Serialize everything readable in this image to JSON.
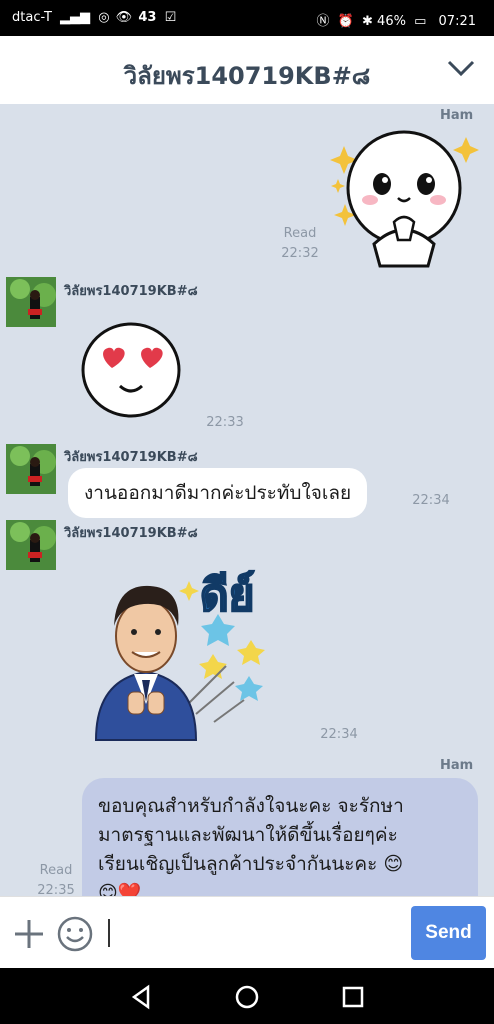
{
  "status_bar": {
    "carrier": "dtac-T",
    "notification_count": "43",
    "battery": "46%",
    "time": "07:21"
  },
  "header": {
    "title": "วิลัยพร140719KB#๘"
  },
  "messages": [
    {
      "side": "out",
      "type": "sticker",
      "sender": "Ham",
      "status": "Read",
      "time": "22:32",
      "sticker": "cute-bun-sparkle-sticker"
    },
    {
      "side": "in",
      "type": "sticker",
      "sender": "วิลัยพร140719KB#๘",
      "time": "22:33",
      "sticker": "heart-eyes-face-sticker"
    },
    {
      "side": "in",
      "type": "text",
      "sender": "วิลัยพร140719KB#๘",
      "time": "22:34",
      "text": "งานออกมาดีมากค่ะประทับใจเลย"
    },
    {
      "side": "in",
      "type": "sticker",
      "sender": "วิลัยพร140719KB#๘",
      "time": "22:34",
      "sticker": "man-in-suit-sticker",
      "sticker_text": "ดีย์"
    },
    {
      "side": "out",
      "type": "text",
      "sender": "Ham",
      "status": "Read",
      "time": "22:35",
      "lines": [
        "ขอบคุณสำหรับกำลังใจนะคะ จะรักษา",
        "มาตรฐานและพัฒนาให้ดีขึ้นเรื่อยๆค่ะ",
        "เรียนเชิญเป็นลูกค้าประจำกันนะคะ 😊",
        "😊❤️"
      ]
    }
  ],
  "input": {
    "placeholder": "",
    "send_label": "Send"
  },
  "colors": {
    "chat_bg": "#d9e0ea",
    "outgoing_bubble": "#c2cbe6",
    "send_button": "#4f86e2"
  }
}
